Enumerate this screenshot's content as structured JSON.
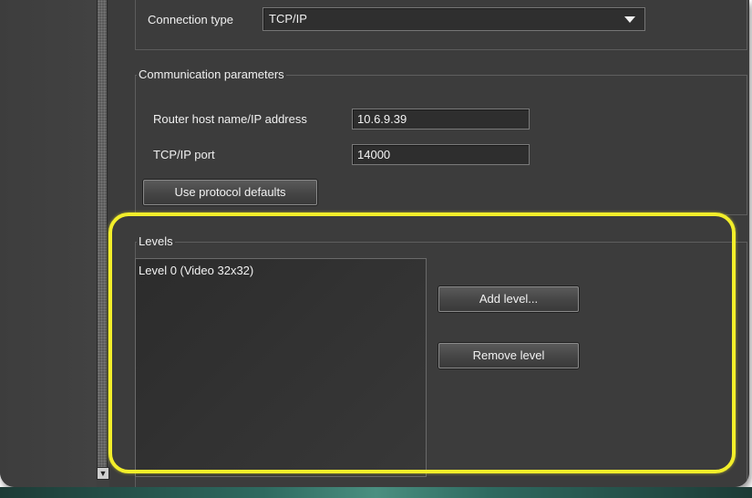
{
  "connection": {
    "label": "Connection type",
    "value": "TCP/IP"
  },
  "communication": {
    "title": "Communication parameters",
    "host_label": "Router host name/IP address",
    "host_value": "10.6.9.39",
    "port_label": "TCP/IP port",
    "port_value": "14000",
    "defaults_button": "Use protocol defaults"
  },
  "levels": {
    "title": "Levels",
    "items": [
      "Level 0 (Video 32x32)"
    ],
    "add_button": "Add level...",
    "remove_button": "Remove level"
  },
  "colors": {
    "panel_bg": "#3c3c3c",
    "highlight": "#f2ee2a"
  },
  "icons": {
    "dropdown": "chevron-down-icon",
    "scroll_down": "arrow-down-icon"
  }
}
